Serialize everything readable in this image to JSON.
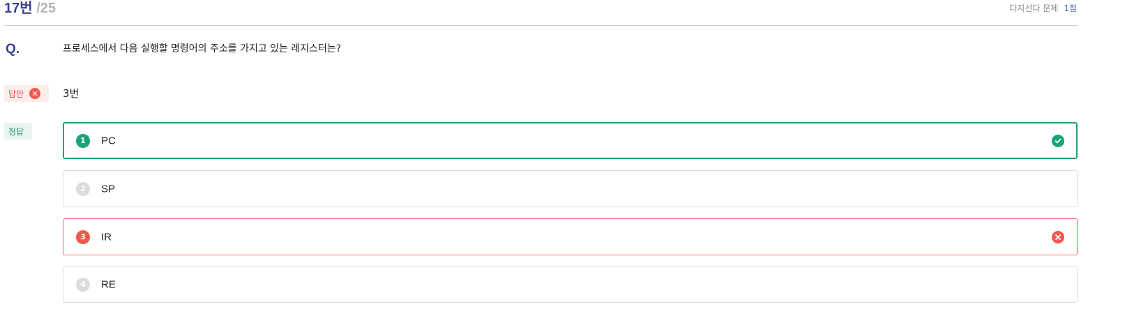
{
  "header": {
    "question_number": "17번",
    "question_total": "/25",
    "question_type": "다지선다 문제",
    "points": "1점"
  },
  "question": {
    "label": "Q.",
    "text": "프로세스에서 다음 실행할 명령어의 주소를 가지고 있는 레지스터는?"
  },
  "answer": {
    "badge_label": "답안",
    "value": "3번",
    "status": "incorrect"
  },
  "correct": {
    "badge_label": "정답"
  },
  "options": [
    {
      "number": "1",
      "label": "PC",
      "state": "correct"
    },
    {
      "number": "2",
      "label": "SP",
      "state": "neutral"
    },
    {
      "number": "3",
      "label": "IR",
      "state": "wrong"
    },
    {
      "number": "4",
      "label": "RE",
      "state": "neutral"
    }
  ],
  "colors": {
    "accent": "#3b3f8f",
    "correct": "#1aa37a",
    "wrong": "#f0594f",
    "muted": "#dcdcdc"
  },
  "icons": {
    "answer_status": "x-circle-icon",
    "correct_option": "check-circle-icon",
    "wrong_option": "x-circle-icon"
  }
}
